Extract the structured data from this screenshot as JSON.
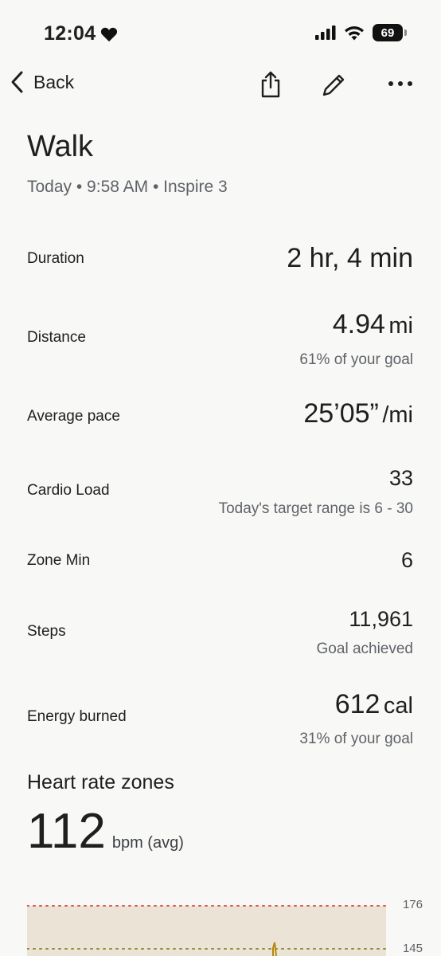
{
  "status_bar": {
    "time": "12:04",
    "battery": "69"
  },
  "nav": {
    "back_label": "Back"
  },
  "activity": {
    "title": "Walk",
    "subtitle": "Today • 9:58 AM • Inspire 3"
  },
  "metrics": {
    "duration": {
      "label": "Duration",
      "value": "2 hr, 4 min"
    },
    "distance": {
      "label": "Distance",
      "value": "4.94",
      "unit": "mi",
      "sub": "61% of your goal"
    },
    "pace": {
      "label": "Average pace",
      "value": "25’05”",
      "unit": "/mi"
    },
    "cardio": {
      "label": "Cardio Load",
      "value": "33",
      "sub": "Today's target range is 6 - 30"
    },
    "zone": {
      "label": "Zone Min",
      "value": "6"
    },
    "steps": {
      "label": "Steps",
      "value": "11,961",
      "sub": "Goal achieved"
    },
    "energy": {
      "label": "Energy burned",
      "value": "612",
      "unit": "cal",
      "sub": "31% of your goal"
    }
  },
  "heart_rate": {
    "title": "Heart rate zones",
    "avg": "112",
    "unit": "bpm (avg)",
    "ticks": [
      "176",
      "145"
    ]
  },
  "colors": {
    "zone_fill": "#ece3d7",
    "max_line": "#d9534f",
    "zone_line": "#8a8f3a",
    "hr_line": "#b8860b"
  }
}
